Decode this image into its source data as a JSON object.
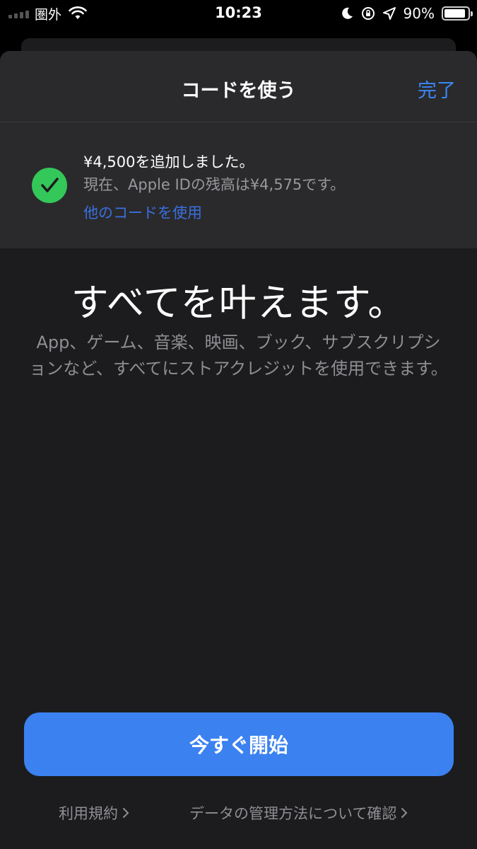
{
  "status_bar": {
    "carrier": "圏外",
    "time": "10:23",
    "battery_percent": "90%",
    "battery_level": 0.9,
    "icons": [
      "signal-icon",
      "wifi-icon",
      "moon-icon",
      "orientation-lock-icon",
      "location-icon",
      "battery-icon"
    ]
  },
  "nav": {
    "title": "コードを使う",
    "done_label": "完了"
  },
  "banner": {
    "line1": "¥4,500を追加しました。",
    "line2": "現在、Apple IDの残高は¥4,575です。",
    "link": "他のコードを使用",
    "icon": "checkmark-circle-icon"
  },
  "main": {
    "headline": "すべてを叶えます。",
    "body": "App、ゲーム、音楽、映画、ブック、サブスクリプションなど、すべてにストアクレジットを使用できます。",
    "cta_label": "今すぐ開始"
  },
  "footer": {
    "terms_label": "利用規約",
    "privacy_label": "データの管理方法について確認"
  },
  "colors": {
    "accent": "#3b87f5",
    "button": "#3b82f0",
    "success": "#34c759",
    "sheet_bg": "#1c1c1e",
    "banner_bg": "#2a2a2c",
    "secondary_text": "#8e8e93"
  }
}
